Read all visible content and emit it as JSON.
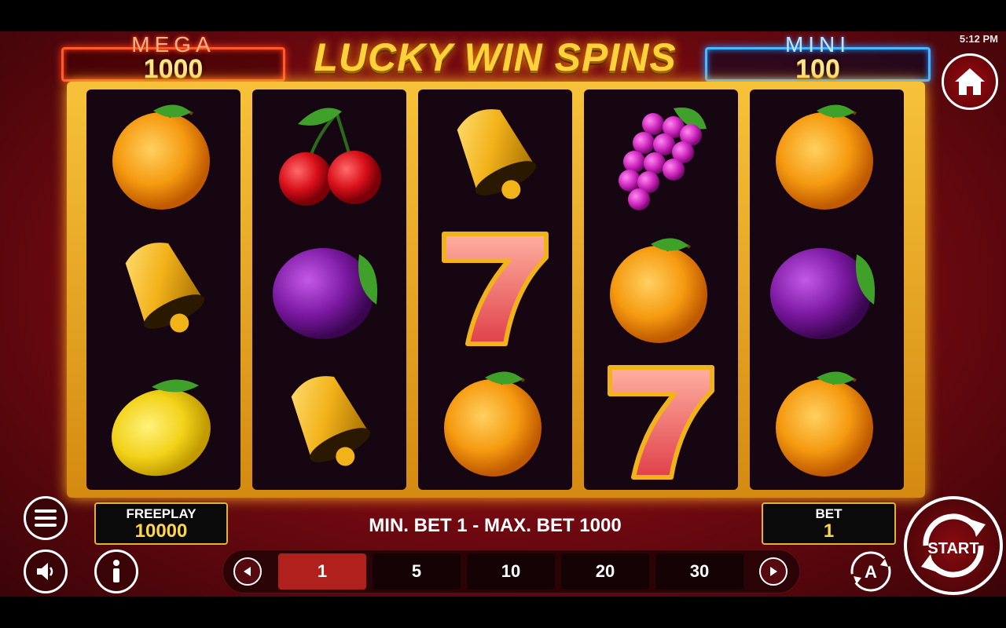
{
  "status_bar": {
    "time": "5:12 PM"
  },
  "title": "LUCKY WIN SPINS",
  "jackpots": {
    "mega": {
      "label": "MEGA",
      "value": "1000"
    },
    "mini": {
      "label": "MINI",
      "value": "100"
    }
  },
  "reels": [
    [
      "orange",
      "bell",
      "lemon"
    ],
    [
      "cherry",
      "plum",
      "bell"
    ],
    [
      "bell",
      "seven",
      "orange"
    ],
    [
      "grapes",
      "orange",
      "seven"
    ],
    [
      "orange",
      "plum",
      "orange"
    ]
  ],
  "freeplay": {
    "label": "FREEPLAY",
    "value": "10000"
  },
  "bet": {
    "label": "BET",
    "value": "1"
  },
  "bet_info": "MIN. BET 1 - MAX. BET 1000",
  "bet_options": [
    "1",
    "5",
    "10",
    "20",
    "30"
  ],
  "selected_bet": "1",
  "buttons": {
    "start_label": "START",
    "auto_label": "A"
  },
  "icons": {
    "home": "home-icon",
    "menu": "hamburger-icon",
    "sound": "speaker-icon",
    "info": "info-icon",
    "prev": "chevron-left-icon",
    "next": "chevron-right-icon",
    "auto": "autoplay-icon",
    "start": "start-spin-icon"
  },
  "colors": {
    "gold": "#ffd23c",
    "mega_glow": "#ff5a2a",
    "mini_glow": "#4ab8ff",
    "active_bet": "#b0201c"
  }
}
